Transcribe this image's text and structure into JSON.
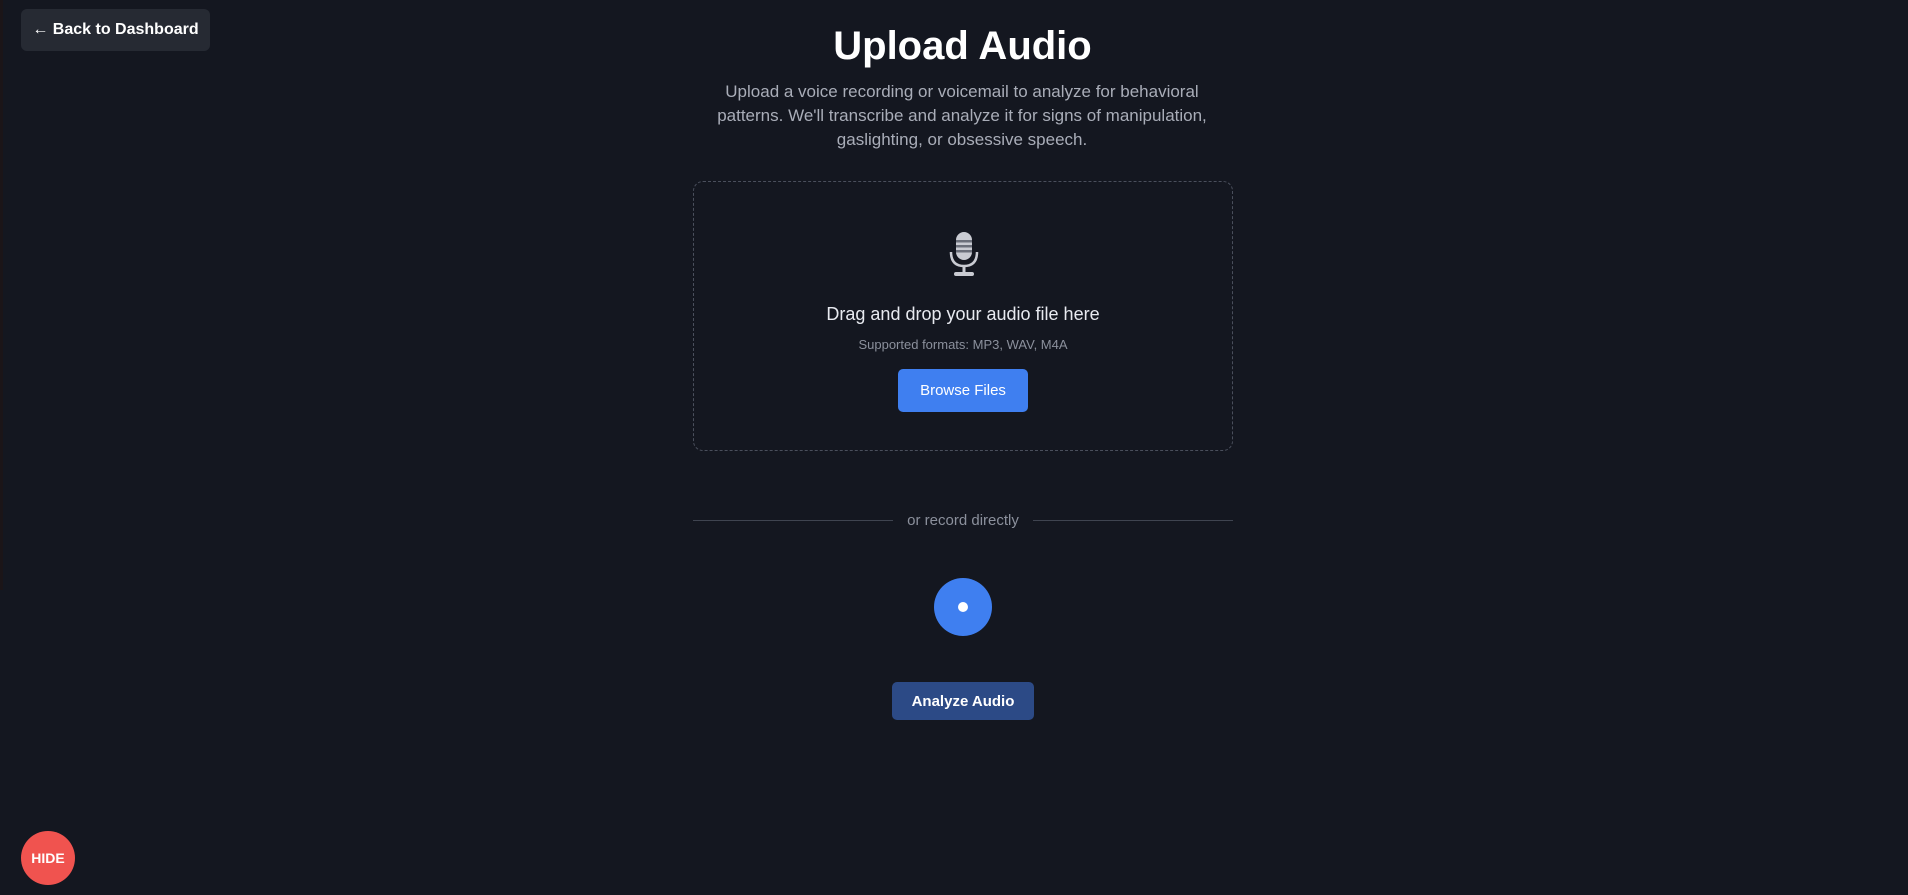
{
  "nav": {
    "back_label": "← Back to Dashboard"
  },
  "header": {
    "title": "Upload Audio",
    "subtitle": "Upload a voice recording or voicemail to analyze for behavioral patterns. We'll transcribe and analyze it for signs of manipulation, gaslighting, or obsessive speech."
  },
  "dropzone": {
    "icon": "microphone-icon",
    "heading": "Drag and drop your audio file here",
    "formats": "Supported formats: MP3, WAV, M4A",
    "browse_label": "Browse Files"
  },
  "divider": {
    "label": "or record directly"
  },
  "record": {
    "icon": "record-dot-icon"
  },
  "actions": {
    "analyze_label": "Analyze Audio"
  },
  "floating": {
    "hide_label": "HIDE"
  },
  "colors": {
    "background": "#141720",
    "accent": "#3f7ff0",
    "analyze": "#2c4a86",
    "hide": "#f0534f"
  }
}
